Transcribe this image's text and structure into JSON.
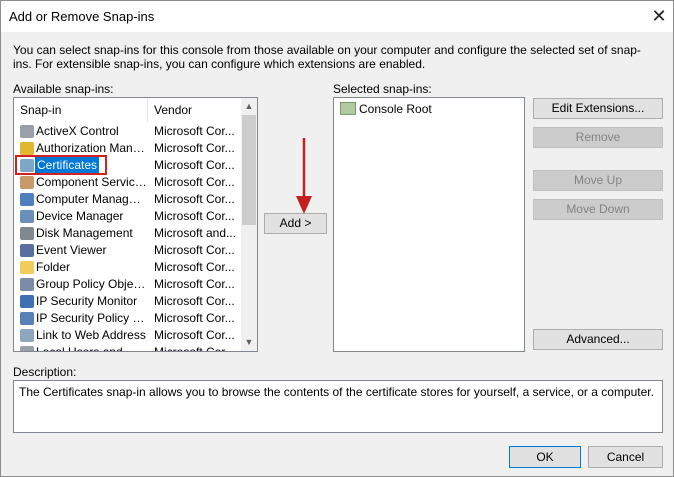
{
  "window": {
    "title": "Add or Remove Snap-ins"
  },
  "intro": "You can select snap-ins for this console from those available on your computer and configure the selected set of snap-ins. For extensible snap-ins, you can configure which extensions are enabled.",
  "available": {
    "label": "Available snap-ins:",
    "headers": {
      "snapin": "Snap-in",
      "vendor": "Vendor"
    },
    "rows": [
      {
        "name": "ActiveX Control",
        "vendor": "Microsoft Cor...",
        "icon": "activex-icon",
        "color": "#9aa0a8"
      },
      {
        "name": "Authorization Manager",
        "vendor": "Microsoft Cor...",
        "icon": "key-icon",
        "color": "#e0b830"
      },
      {
        "name": "Certificates",
        "vendor": "Microsoft Cor...",
        "icon": "certificate-icon",
        "color": "#7ea6c9"
      },
      {
        "name": "Component Services",
        "vendor": "Microsoft Cor...",
        "icon": "component-icon",
        "color": "#c89a6a"
      },
      {
        "name": "Computer Managem...",
        "vendor": "Microsoft Cor...",
        "icon": "computer-icon",
        "color": "#4f7fbf"
      },
      {
        "name": "Device Manager",
        "vendor": "Microsoft Cor...",
        "icon": "device-icon",
        "color": "#6a8fb8"
      },
      {
        "name": "Disk Management",
        "vendor": "Microsoft and...",
        "icon": "disk-icon",
        "color": "#808890"
      },
      {
        "name": "Event Viewer",
        "vendor": "Microsoft Cor...",
        "icon": "event-icon",
        "color": "#5a6fa0"
      },
      {
        "name": "Folder",
        "vendor": "Microsoft Cor...",
        "icon": "folder-icon",
        "color": "#f0cc5a"
      },
      {
        "name": "Group Policy Object ...",
        "vendor": "Microsoft Cor...",
        "icon": "policy-icon",
        "color": "#7a8ca8"
      },
      {
        "name": "IP Security Monitor",
        "vendor": "Microsoft Cor...",
        "icon": "monitor-icon",
        "color": "#3f6fb0"
      },
      {
        "name": "IP Security Policy M...",
        "vendor": "Microsoft Cor...",
        "icon": "security-policy-icon",
        "color": "#5a80b8"
      },
      {
        "name": "Link to Web Address",
        "vendor": "Microsoft Cor...",
        "icon": "link-icon",
        "color": "#8fa6c0"
      },
      {
        "name": "Local Users and Gro...",
        "vendor": "Microsoft Cor...",
        "icon": "users-icon",
        "color": "#9aa0a8"
      }
    ],
    "selected_index": 2
  },
  "add_button": "Add >",
  "selected": {
    "label": "Selected snap-ins:",
    "root": "Console Root"
  },
  "buttons": {
    "edit_extensions": "Edit Extensions...",
    "remove": "Remove",
    "move_up": "Move Up",
    "move_down": "Move Down",
    "advanced": "Advanced...",
    "ok": "OK",
    "cancel": "Cancel"
  },
  "description": {
    "label": "Description:",
    "text": "The Certificates snap-in allows you to browse the contents of the certificate stores for yourself, a service, or a computer."
  },
  "colors": {
    "selection": "#0078d7",
    "highlight_box": "#d32020",
    "arrow": "#c42020"
  }
}
